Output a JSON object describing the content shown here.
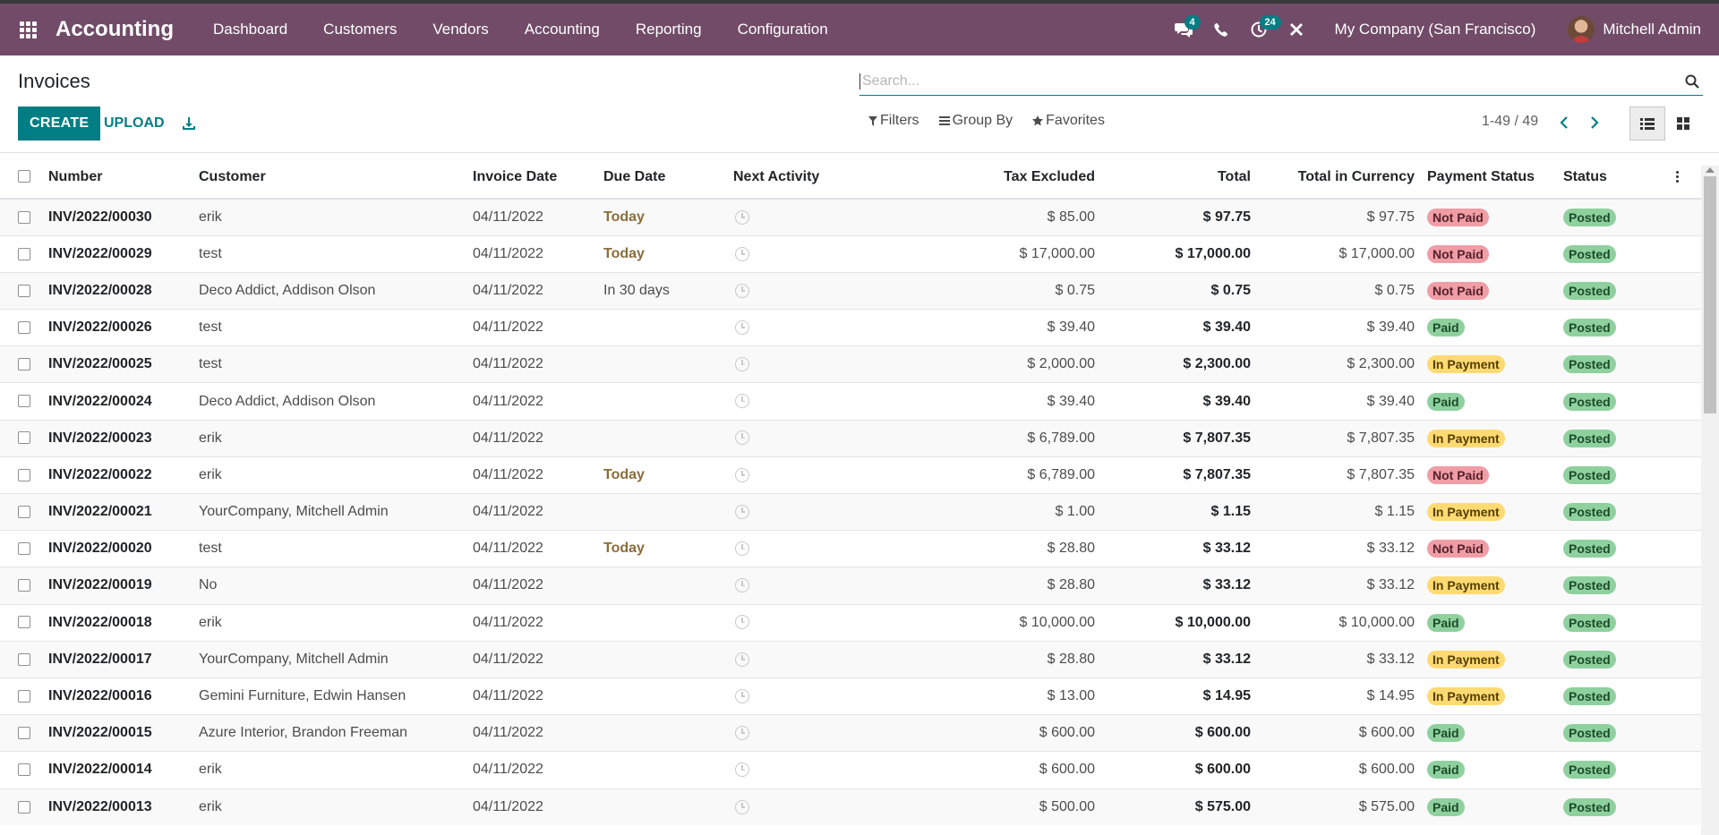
{
  "app": {
    "name": "Accounting"
  },
  "menu": [
    "Dashboard",
    "Customers",
    "Vendors",
    "Accounting",
    "Reporting",
    "Configuration"
  ],
  "systray": {
    "messages_count": "4",
    "activities_count": "24"
  },
  "company": "My Company (San Francisco)",
  "user": "Mitchell Admin",
  "breadcrumb": "Invoices",
  "search": {
    "placeholder": "Search..."
  },
  "buttons": {
    "create": "CREATE",
    "upload": "UPLOAD"
  },
  "filters": {
    "filters": "Filters",
    "group_by": "Group By",
    "favorites": "Favorites"
  },
  "pager": "1-49 / 49",
  "columns": {
    "number": "Number",
    "customer": "Customer",
    "invoice_date": "Invoice Date",
    "due_date": "Due Date",
    "next_activity": "Next Activity",
    "tax_excluded": "Tax Excluded",
    "total": "Total",
    "total_currency": "Total in Currency",
    "payment_status": "Payment Status",
    "status": "Status"
  },
  "rows": [
    {
      "number": "INV/2022/00030",
      "customer": "erik",
      "invoice_date": "04/11/2022",
      "due": "Today",
      "tax_excluded": "$ 85.00",
      "total": "$ 97.75",
      "total_currency": "$ 97.75",
      "payment_status": "Not Paid",
      "status": "Posted"
    },
    {
      "number": "INV/2022/00029",
      "customer": "test",
      "invoice_date": "04/11/2022",
      "due": "Today",
      "tax_excluded": "$ 17,000.00",
      "total": "$ 17,000.00",
      "total_currency": "$ 17,000.00",
      "payment_status": "Not Paid",
      "status": "Posted"
    },
    {
      "number": "INV/2022/00028",
      "customer": "Deco Addict, Addison Olson",
      "invoice_date": "04/11/2022",
      "due": "In 30 days",
      "tax_excluded": "$ 0.75",
      "total": "$ 0.75",
      "total_currency": "$ 0.75",
      "payment_status": "Not Paid",
      "status": "Posted"
    },
    {
      "number": "INV/2022/00026",
      "customer": "test",
      "invoice_date": "04/11/2022",
      "due": "",
      "tax_excluded": "$ 39.40",
      "total": "$ 39.40",
      "total_currency": "$ 39.40",
      "payment_status": "Paid",
      "status": "Posted"
    },
    {
      "number": "INV/2022/00025",
      "customer": "test",
      "invoice_date": "04/11/2022",
      "due": "",
      "tax_excluded": "$ 2,000.00",
      "total": "$ 2,300.00",
      "total_currency": "$ 2,300.00",
      "payment_status": "In Payment",
      "status": "Posted"
    },
    {
      "number": "INV/2022/00024",
      "customer": "Deco Addict, Addison Olson",
      "invoice_date": "04/11/2022",
      "due": "",
      "tax_excluded": "$ 39.40",
      "total": "$ 39.40",
      "total_currency": "$ 39.40",
      "payment_status": "Paid",
      "status": "Posted"
    },
    {
      "number": "INV/2022/00023",
      "customer": "erik",
      "invoice_date": "04/11/2022",
      "due": "",
      "tax_excluded": "$ 6,789.00",
      "total": "$ 7,807.35",
      "total_currency": "$ 7,807.35",
      "payment_status": "In Payment",
      "status": "Posted"
    },
    {
      "number": "INV/2022/00022",
      "customer": "erik",
      "invoice_date": "04/11/2022",
      "due": "Today",
      "tax_excluded": "$ 6,789.00",
      "total": "$ 7,807.35",
      "total_currency": "$ 7,807.35",
      "payment_status": "Not Paid",
      "status": "Posted"
    },
    {
      "number": "INV/2022/00021",
      "customer": "YourCompany, Mitchell Admin",
      "invoice_date": "04/11/2022",
      "due": "",
      "tax_excluded": "$ 1.00",
      "total": "$ 1.15",
      "total_currency": "$ 1.15",
      "payment_status": "In Payment",
      "status": "Posted"
    },
    {
      "number": "INV/2022/00020",
      "customer": "test",
      "invoice_date": "04/11/2022",
      "due": "Today",
      "tax_excluded": "$ 28.80",
      "total": "$ 33.12",
      "total_currency": "$ 33.12",
      "payment_status": "Not Paid",
      "status": "Posted"
    },
    {
      "number": "INV/2022/00019",
      "customer": "No",
      "invoice_date": "04/11/2022",
      "due": "",
      "tax_excluded": "$ 28.80",
      "total": "$ 33.12",
      "total_currency": "$ 33.12",
      "payment_status": "In Payment",
      "status": "Posted"
    },
    {
      "number": "INV/2022/00018",
      "customer": "erik",
      "invoice_date": "04/11/2022",
      "due": "",
      "tax_excluded": "$ 10,000.00",
      "total": "$ 10,000.00",
      "total_currency": "$ 10,000.00",
      "payment_status": "Paid",
      "status": "Posted"
    },
    {
      "number": "INV/2022/00017",
      "customer": "YourCompany, Mitchell Admin",
      "invoice_date": "04/11/2022",
      "due": "",
      "tax_excluded": "$ 28.80",
      "total": "$ 33.12",
      "total_currency": "$ 33.12",
      "payment_status": "In Payment",
      "status": "Posted"
    },
    {
      "number": "INV/2022/00016",
      "customer": "Gemini Furniture, Edwin Hansen",
      "invoice_date": "04/11/2022",
      "due": "",
      "tax_excluded": "$ 13.00",
      "total": "$ 14.95",
      "total_currency": "$ 14.95",
      "payment_status": "In Payment",
      "status": "Posted"
    },
    {
      "number": "INV/2022/00015",
      "customer": "Azure Interior, Brandon Freeman",
      "invoice_date": "04/11/2022",
      "due": "",
      "tax_excluded": "$ 600.00",
      "total": "$ 600.00",
      "total_currency": "$ 600.00",
      "payment_status": "Paid",
      "status": "Posted"
    },
    {
      "number": "INV/2022/00014",
      "customer": "erik",
      "invoice_date": "04/11/2022",
      "due": "",
      "tax_excluded": "$ 600.00",
      "total": "$ 600.00",
      "total_currency": "$ 600.00",
      "payment_status": "Paid",
      "status": "Posted"
    },
    {
      "number": "INV/2022/00013",
      "customer": "erik",
      "invoice_date": "04/11/2022",
      "due": "",
      "tax_excluded": "$ 500.00",
      "total": "$ 575.00",
      "total_currency": "$ 575.00",
      "payment_status": "Paid",
      "status": "Posted"
    }
  ]
}
